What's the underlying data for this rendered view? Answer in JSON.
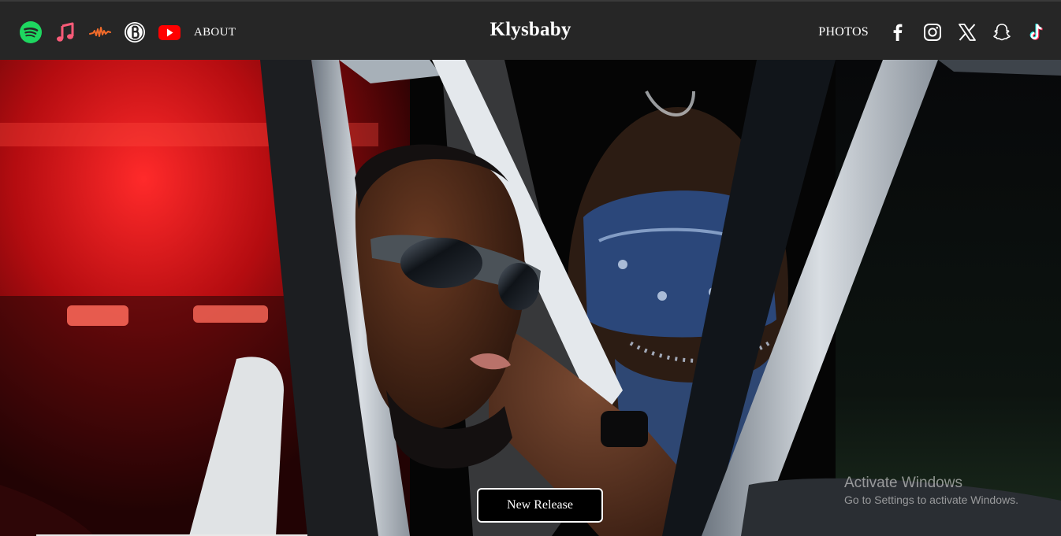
{
  "header": {
    "brand": "Klysbaby",
    "left_icons": [
      "spotify-icon",
      "apple-music-icon",
      "audiomack-icon",
      "boomplay-icon",
      "youtube-icon"
    ],
    "about_label": "ABOUT",
    "photos_label": "PHOTOS",
    "right_icons": [
      "facebook-icon",
      "instagram-icon",
      "x-icon",
      "snapchat-icon",
      "tiktok-icon"
    ]
  },
  "colors": {
    "header_bg": "#262626",
    "spotify": "#1ed760",
    "apple_music": "#fa5b78",
    "audiomack": "#f26b2a",
    "youtube": "#ff0000",
    "button_bg": "#000000",
    "button_border": "#ffffff"
  },
  "hero": {
    "button_label": "New Release"
  },
  "system": {
    "watermark_title": "Activate Windows",
    "watermark_subtitle": "Go to Settings to activate Windows."
  }
}
